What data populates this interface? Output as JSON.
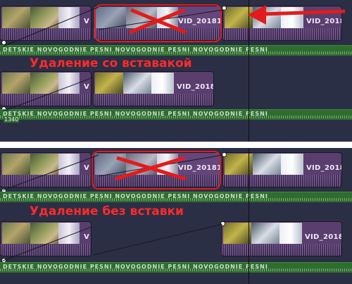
{
  "panels": {
    "top": {
      "clips_row1": [
        {
          "title": "V"
        },
        {
          "title": "VID_20181"
        },
        {
          "title": "VID_2018"
        }
      ],
      "audio1_label": "DETSKIE NOVOGODNIE PESNI NOVOGODNIE PESNI NOVOGODNIE PESNI",
      "caption": "Удаление со вставакой",
      "clips_row2": [
        {
          "title": "V"
        },
        {
          "title": "VID_2018"
        }
      ],
      "audio2_label": "DETSKIE NOVOGODNIE PESNI NOVOGODNIE PESNI NOVOGODNIE PESNI",
      "timecode": "1340"
    },
    "bottom": {
      "clips_row1": [
        {
          "title": "V"
        },
        {
          "title": "VID_20181"
        },
        {
          "title": "VID_2018"
        }
      ],
      "audio1_label": "DETSKIE NOVOGODNIE PESNI NOVOGODNIE PESNI NOVOGODNIE PESNI",
      "caption": "Удаление без вставки",
      "clips_row2": [
        {
          "title": "V"
        },
        {
          "title": "VID_2018"
        }
      ],
      "audio2_label": "DETSKIE NOVOGODNIE PESNI NOVOGODNIE PESNI NOVOGODNIE PESNI"
    }
  },
  "colors": {
    "annotation_red": "#e31b1b",
    "clip_purple": "#5a3e6e",
    "audio_green": "#2f6d2f",
    "background": "#2b2f45"
  }
}
